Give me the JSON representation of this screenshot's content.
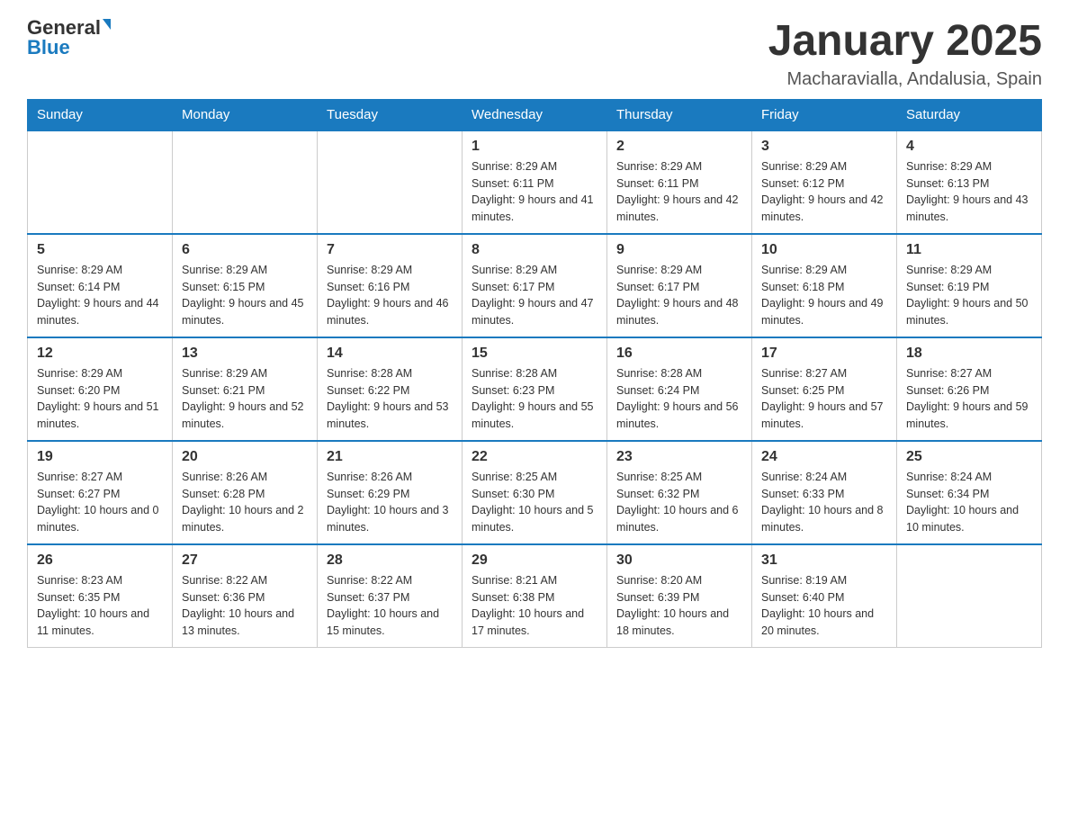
{
  "logo": {
    "text_general": "General",
    "text_blue": "Blue"
  },
  "header": {
    "month_title": "January 2025",
    "location": "Macharavialla, Andalusia, Spain"
  },
  "days_of_week": [
    "Sunday",
    "Monday",
    "Tuesday",
    "Wednesday",
    "Thursday",
    "Friday",
    "Saturday"
  ],
  "weeks": [
    [
      {
        "day": "",
        "info": ""
      },
      {
        "day": "",
        "info": ""
      },
      {
        "day": "",
        "info": ""
      },
      {
        "day": "1",
        "info": "Sunrise: 8:29 AM\nSunset: 6:11 PM\nDaylight: 9 hours and 41 minutes."
      },
      {
        "day": "2",
        "info": "Sunrise: 8:29 AM\nSunset: 6:11 PM\nDaylight: 9 hours and 42 minutes."
      },
      {
        "day": "3",
        "info": "Sunrise: 8:29 AM\nSunset: 6:12 PM\nDaylight: 9 hours and 42 minutes."
      },
      {
        "day": "4",
        "info": "Sunrise: 8:29 AM\nSunset: 6:13 PM\nDaylight: 9 hours and 43 minutes."
      }
    ],
    [
      {
        "day": "5",
        "info": "Sunrise: 8:29 AM\nSunset: 6:14 PM\nDaylight: 9 hours and 44 minutes."
      },
      {
        "day": "6",
        "info": "Sunrise: 8:29 AM\nSunset: 6:15 PM\nDaylight: 9 hours and 45 minutes."
      },
      {
        "day": "7",
        "info": "Sunrise: 8:29 AM\nSunset: 6:16 PM\nDaylight: 9 hours and 46 minutes."
      },
      {
        "day": "8",
        "info": "Sunrise: 8:29 AM\nSunset: 6:17 PM\nDaylight: 9 hours and 47 minutes."
      },
      {
        "day": "9",
        "info": "Sunrise: 8:29 AM\nSunset: 6:17 PM\nDaylight: 9 hours and 48 minutes."
      },
      {
        "day": "10",
        "info": "Sunrise: 8:29 AM\nSunset: 6:18 PM\nDaylight: 9 hours and 49 minutes."
      },
      {
        "day": "11",
        "info": "Sunrise: 8:29 AM\nSunset: 6:19 PM\nDaylight: 9 hours and 50 minutes."
      }
    ],
    [
      {
        "day": "12",
        "info": "Sunrise: 8:29 AM\nSunset: 6:20 PM\nDaylight: 9 hours and 51 minutes."
      },
      {
        "day": "13",
        "info": "Sunrise: 8:29 AM\nSunset: 6:21 PM\nDaylight: 9 hours and 52 minutes."
      },
      {
        "day": "14",
        "info": "Sunrise: 8:28 AM\nSunset: 6:22 PM\nDaylight: 9 hours and 53 minutes."
      },
      {
        "day": "15",
        "info": "Sunrise: 8:28 AM\nSunset: 6:23 PM\nDaylight: 9 hours and 55 minutes."
      },
      {
        "day": "16",
        "info": "Sunrise: 8:28 AM\nSunset: 6:24 PM\nDaylight: 9 hours and 56 minutes."
      },
      {
        "day": "17",
        "info": "Sunrise: 8:27 AM\nSunset: 6:25 PM\nDaylight: 9 hours and 57 minutes."
      },
      {
        "day": "18",
        "info": "Sunrise: 8:27 AM\nSunset: 6:26 PM\nDaylight: 9 hours and 59 minutes."
      }
    ],
    [
      {
        "day": "19",
        "info": "Sunrise: 8:27 AM\nSunset: 6:27 PM\nDaylight: 10 hours and 0 minutes."
      },
      {
        "day": "20",
        "info": "Sunrise: 8:26 AM\nSunset: 6:28 PM\nDaylight: 10 hours and 2 minutes."
      },
      {
        "day": "21",
        "info": "Sunrise: 8:26 AM\nSunset: 6:29 PM\nDaylight: 10 hours and 3 minutes."
      },
      {
        "day": "22",
        "info": "Sunrise: 8:25 AM\nSunset: 6:30 PM\nDaylight: 10 hours and 5 minutes."
      },
      {
        "day": "23",
        "info": "Sunrise: 8:25 AM\nSunset: 6:32 PM\nDaylight: 10 hours and 6 minutes."
      },
      {
        "day": "24",
        "info": "Sunrise: 8:24 AM\nSunset: 6:33 PM\nDaylight: 10 hours and 8 minutes."
      },
      {
        "day": "25",
        "info": "Sunrise: 8:24 AM\nSunset: 6:34 PM\nDaylight: 10 hours and 10 minutes."
      }
    ],
    [
      {
        "day": "26",
        "info": "Sunrise: 8:23 AM\nSunset: 6:35 PM\nDaylight: 10 hours and 11 minutes."
      },
      {
        "day": "27",
        "info": "Sunrise: 8:22 AM\nSunset: 6:36 PM\nDaylight: 10 hours and 13 minutes."
      },
      {
        "day": "28",
        "info": "Sunrise: 8:22 AM\nSunset: 6:37 PM\nDaylight: 10 hours and 15 minutes."
      },
      {
        "day": "29",
        "info": "Sunrise: 8:21 AM\nSunset: 6:38 PM\nDaylight: 10 hours and 17 minutes."
      },
      {
        "day": "30",
        "info": "Sunrise: 8:20 AM\nSunset: 6:39 PM\nDaylight: 10 hours and 18 minutes."
      },
      {
        "day": "31",
        "info": "Sunrise: 8:19 AM\nSunset: 6:40 PM\nDaylight: 10 hours and 20 minutes."
      },
      {
        "day": "",
        "info": ""
      }
    ]
  ]
}
